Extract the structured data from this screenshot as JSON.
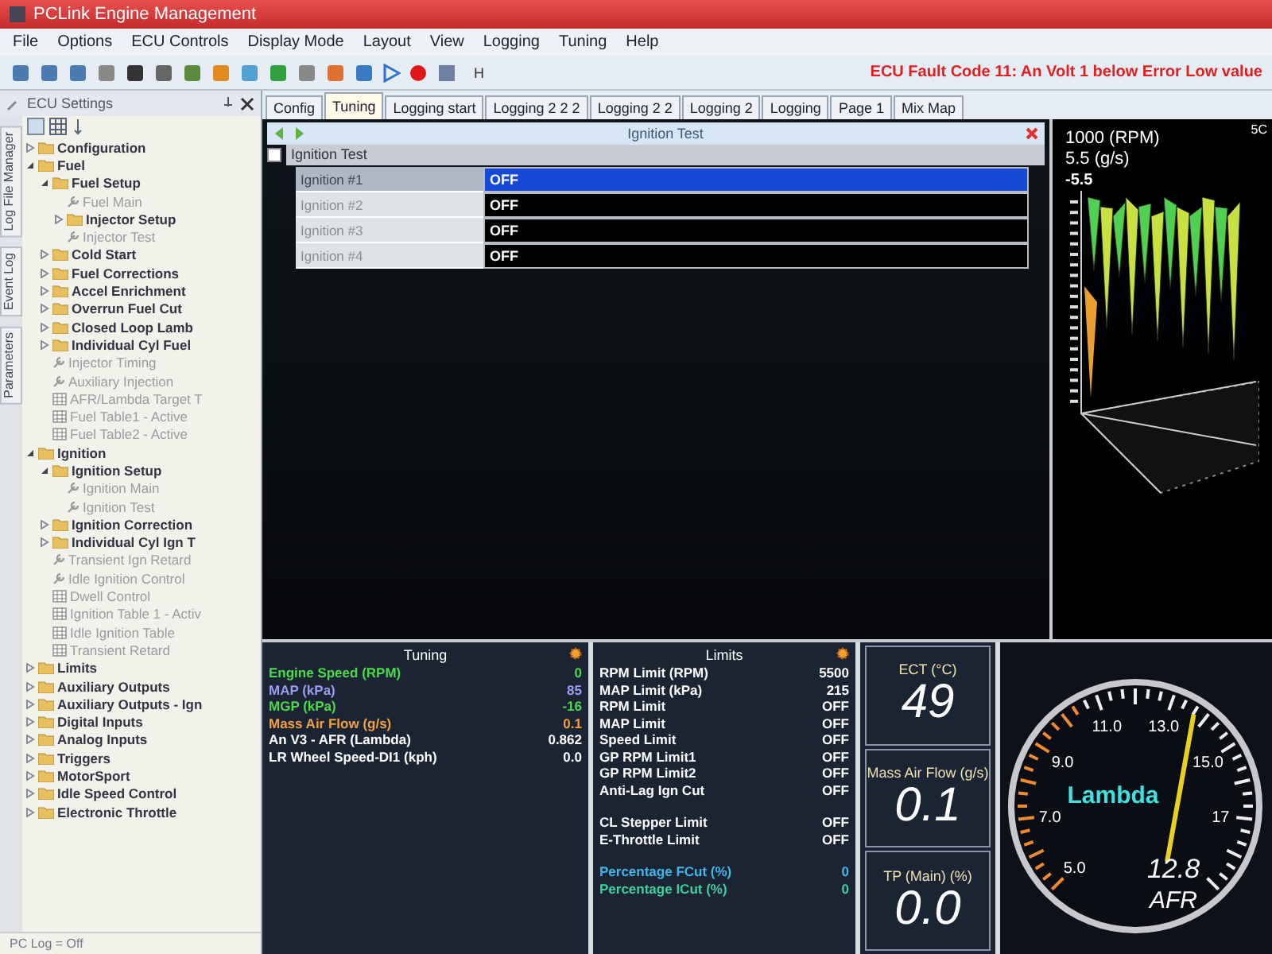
{
  "window": {
    "title": "PCLink Engine Management"
  },
  "menu": [
    "File",
    "Options",
    "ECU Controls",
    "Display Mode",
    "Layout",
    "View",
    "Logging",
    "Tuning",
    "Help"
  ],
  "toolbar": {
    "text": "H",
    "fault": "ECU Fault Code 11: An Volt 1 below Error Low value"
  },
  "sidebar": {
    "title": "ECU Settings",
    "side_tabs": [
      "Log File Manager",
      "Event Log",
      "Parameters"
    ],
    "tree": [
      {
        "label": "Configuration",
        "kind": "folder",
        "expanded": false
      },
      {
        "label": "Fuel",
        "kind": "folder",
        "expanded": true,
        "children": [
          {
            "label": "Fuel Setup",
            "kind": "folder",
            "expanded": true,
            "children": [
              {
                "label": "Fuel Main",
                "kind": "setting"
              },
              {
                "label": "Injector Setup",
                "kind": "folder",
                "expanded": false
              },
              {
                "label": "Injector Test",
                "kind": "setting"
              }
            ]
          },
          {
            "label": "Cold Start",
            "kind": "folder",
            "expanded": false
          },
          {
            "label": "Fuel Corrections",
            "kind": "folder",
            "expanded": false
          },
          {
            "label": "Accel Enrichment",
            "kind": "folder",
            "expanded": false
          },
          {
            "label": "Overrun Fuel Cut",
            "kind": "folder",
            "expanded": false
          },
          {
            "label": "Closed Loop Lamb",
            "kind": "folder",
            "expanded": false
          },
          {
            "label": "Individual Cyl Fuel",
            "kind": "folder",
            "expanded": false
          },
          {
            "label": "Injector Timing",
            "kind": "setting"
          },
          {
            "label": "Auxiliary Injection",
            "kind": "setting"
          },
          {
            "label": "AFR/Lambda Target T",
            "kind": "table"
          },
          {
            "label": "Fuel Table1 - Active",
            "kind": "table"
          },
          {
            "label": "Fuel Table2 - Active",
            "kind": "table"
          }
        ]
      },
      {
        "label": "Ignition",
        "kind": "folder",
        "expanded": true,
        "children": [
          {
            "label": "Ignition Setup",
            "kind": "folder",
            "expanded": true,
            "children": [
              {
                "label": "Ignition Main",
                "kind": "setting"
              },
              {
                "label": "Ignition Test",
                "kind": "setting"
              }
            ]
          },
          {
            "label": "Ignition Correction",
            "kind": "folder",
            "expanded": false
          },
          {
            "label": "Individual Cyl Ign T",
            "kind": "folder",
            "expanded": false
          },
          {
            "label": "Transient Ign Retard",
            "kind": "setting"
          },
          {
            "label": "Idle Ignition Control",
            "kind": "setting"
          },
          {
            "label": "Dwell Control",
            "kind": "table"
          },
          {
            "label": "Ignition Table 1 - Activ",
            "kind": "table"
          },
          {
            "label": "Idle Ignition Table",
            "kind": "table"
          },
          {
            "label": "Transient Retard",
            "kind": "table"
          }
        ]
      },
      {
        "label": "Limits",
        "kind": "folder",
        "expanded": false
      },
      {
        "label": "Auxiliary Outputs",
        "kind": "folder",
        "expanded": false
      },
      {
        "label": "Auxiliary Outputs - Ign",
        "kind": "folder",
        "expanded": false
      },
      {
        "label": "Digital Inputs",
        "kind": "folder",
        "expanded": false
      },
      {
        "label": "Analog Inputs",
        "kind": "folder",
        "expanded": false
      },
      {
        "label": "Triggers",
        "kind": "folder",
        "expanded": false
      },
      {
        "label": "MotorSport",
        "kind": "folder",
        "expanded": false
      },
      {
        "label": "Idle Speed Control",
        "kind": "folder",
        "expanded": false
      },
      {
        "label": "Electronic Throttle",
        "kind": "folder",
        "expanded": false
      }
    ]
  },
  "tabs": [
    {
      "label": "Config",
      "selected": false
    },
    {
      "label": "Tuning",
      "selected": true
    },
    {
      "label": "Logging start",
      "selected": false
    },
    {
      "label": "Logging 2 2 2",
      "selected": false
    },
    {
      "label": "Logging 2 2",
      "selected": false
    },
    {
      "label": "Logging 2",
      "selected": false
    },
    {
      "label": "Logging",
      "selected": false
    },
    {
      "label": "Page 1",
      "selected": false
    },
    {
      "label": "Mix Map",
      "selected": false
    }
  ],
  "ignition_test": {
    "title": "Ignition Test",
    "group": "Ignition Test",
    "rows": [
      {
        "name": "Ignition #1",
        "value": "OFF",
        "selected": true
      },
      {
        "name": "Ignition #2",
        "value": "OFF",
        "selected": false
      },
      {
        "name": "Ignition #3",
        "value": "OFF",
        "selected": false
      },
      {
        "name": "Ignition #4",
        "value": "OFF",
        "selected": false
      }
    ]
  },
  "surface_plot": {
    "rpm": "1000 (RPM)",
    "flow": "5.5 (g/s)",
    "value": "-5.5",
    "corner": "5C"
  },
  "tuning": {
    "title": "Tuning",
    "rows": [
      {
        "label": "Engine Speed (RPM)",
        "value": "0",
        "color": "#4cd94c"
      },
      {
        "label": "MAP (kPa)",
        "value": "85",
        "color": "#9a9cf0"
      },
      {
        "label": "MGP (kPa)",
        "value": "-16",
        "color": "#4cd94c"
      },
      {
        "label": "Mass Air Flow (g/s)",
        "value": "0.1",
        "color": "#f0a040"
      },
      {
        "label": "An V3 - AFR (Lambda)",
        "value": "0.862",
        "color": "#ffffff"
      },
      {
        "label": "LR Wheel Speed-DI1 (kph)",
        "value": "0.0",
        "color": "#ffffff"
      }
    ]
  },
  "limits": {
    "title": "Limits",
    "sections": [
      [
        {
          "label": "RPM Limit (RPM)",
          "value": "5500",
          "color": "#ffffff"
        },
        {
          "label": "MAP Limit (kPa)",
          "value": "215",
          "color": "#ffffff"
        },
        {
          "label": "RPM Limit",
          "value": "OFF",
          "color": "#ffffff"
        },
        {
          "label": "MAP Limit",
          "value": "OFF",
          "color": "#ffffff"
        },
        {
          "label": "Speed Limit",
          "value": "OFF",
          "color": "#ffffff"
        },
        {
          "label": "GP RPM Limit1",
          "value": "OFF",
          "color": "#ffffff"
        },
        {
          "label": "GP RPM Limit2",
          "value": "OFF",
          "color": "#ffffff"
        },
        {
          "label": "Anti-Lag Ign Cut",
          "value": "OFF",
          "color": "#ffffff"
        }
      ],
      [
        {
          "label": "CL Stepper Limit",
          "value": "OFF",
          "color": "#ffffff"
        },
        {
          "label": "E-Throttle Limit",
          "value": "OFF",
          "color": "#ffffff"
        }
      ],
      [
        {
          "label": "Percentage FCut (%)",
          "value": "0",
          "color": "#3fb8e8"
        },
        {
          "label": "Percentage ICut (%)",
          "value": "0",
          "color": "#3fd0a0"
        }
      ]
    ]
  },
  "readouts": [
    {
      "label": "ECT (°C)",
      "value": "49"
    },
    {
      "label": "Mass Air Flow (g/s)",
      "value": "0.1"
    },
    {
      "label": "TP (Main) (%)",
      "value": "0.0"
    }
  ],
  "lambda_gauge": {
    "title": "Lambda",
    "ticks": [
      "5.0",
      "7.0",
      "9.0",
      "11.0",
      "13.0",
      "15.0",
      "17"
    ],
    "value": "12.8",
    "unit": "AFR",
    "level": 0.56
  },
  "status_bar": [
    "PC Log = Off"
  ]
}
